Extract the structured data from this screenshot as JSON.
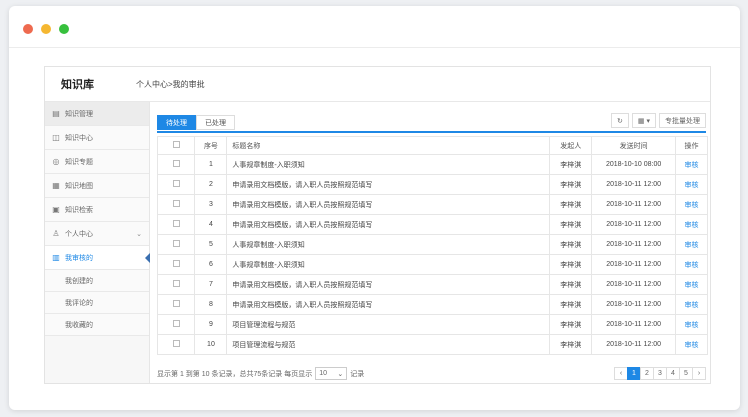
{
  "window": {
    "dot_colors": [
      "#ee6a4f",
      "#f5b731",
      "#37c03d"
    ]
  },
  "header": {
    "title": "知识库",
    "breadcrumb": "个人中心>我的审批"
  },
  "sidebar": {
    "items": [
      {
        "label": "知识管理",
        "icon": "document-icon"
      },
      {
        "label": "知识中心",
        "icon": "book-icon"
      },
      {
        "label": "知识专题",
        "icon": "topic-icon"
      },
      {
        "label": "知识地图",
        "icon": "map-icon"
      },
      {
        "label": "知识检索",
        "icon": "search-doc-icon"
      },
      {
        "label": "个人中心",
        "icon": "user-icon"
      },
      {
        "label": "我审核的",
        "icon": "approve-icon"
      }
    ],
    "subitems": [
      "我创建的",
      "我评论的",
      "我收藏的"
    ]
  },
  "tabs": [
    "待处理",
    "已处理"
  ],
  "toolbar": {
    "refresh_icon": "refresh-icon",
    "columns_icon": "grid-icon",
    "batch_label": "专批量处理"
  },
  "table": {
    "headers": [
      "序号",
      "标题名称",
      "发起人",
      "发送时间",
      "操作"
    ],
    "rows": [
      {
        "no": "1",
        "title": "人事规章制度-入职须知",
        "sender": "李梓淇",
        "time": "2018-10-10 08:00",
        "op": "审核"
      },
      {
        "no": "2",
        "title": "申请录用文档模版，请入职人员按照规范填写",
        "sender": "李梓淇",
        "time": "2018-10-11 12:00",
        "op": "审核"
      },
      {
        "no": "3",
        "title": "申请录用文档模版，请入职人员按照规范填写",
        "sender": "李梓淇",
        "time": "2018-10-11 12:00",
        "op": "审核"
      },
      {
        "no": "4",
        "title": "申请录用文档模版，请入职人员按照规范填写",
        "sender": "李梓淇",
        "time": "2018-10-11 12:00",
        "op": "审核"
      },
      {
        "no": "5",
        "title": "人事规章制度-入职须知",
        "sender": "李梓淇",
        "time": "2018-10-11 12:00",
        "op": "审核"
      },
      {
        "no": "6",
        "title": "人事规章制度-入职须知",
        "sender": "李梓淇",
        "time": "2018-10-11 12:00",
        "op": "审核"
      },
      {
        "no": "7",
        "title": "申请录用文档模版，请入职人员按照规范填写",
        "sender": "李梓淇",
        "time": "2018-10-11 12:00",
        "op": "审核"
      },
      {
        "no": "8",
        "title": "申请录用文档模版，请入职人员按照规范填写",
        "sender": "李梓淇",
        "time": "2018-10-11 12:00",
        "op": "审核"
      },
      {
        "no": "9",
        "title": "项目管理流程与规范",
        "sender": "李梓淇",
        "time": "2018-10-11 12:00",
        "op": "审核"
      },
      {
        "no": "10",
        "title": "项目管理流程与规范",
        "sender": "李梓淇",
        "time": "2018-10-11 12:00",
        "op": "审核"
      }
    ]
  },
  "footer": {
    "summary": "显示第 1 到第 10 条记录，总共75条记录 每页显示",
    "page_size": "10",
    "suffix": "记录"
  },
  "pagination": {
    "prev": "‹",
    "pages": [
      "1",
      "2",
      "3",
      "4",
      "5"
    ],
    "next": "›",
    "current": "1"
  }
}
